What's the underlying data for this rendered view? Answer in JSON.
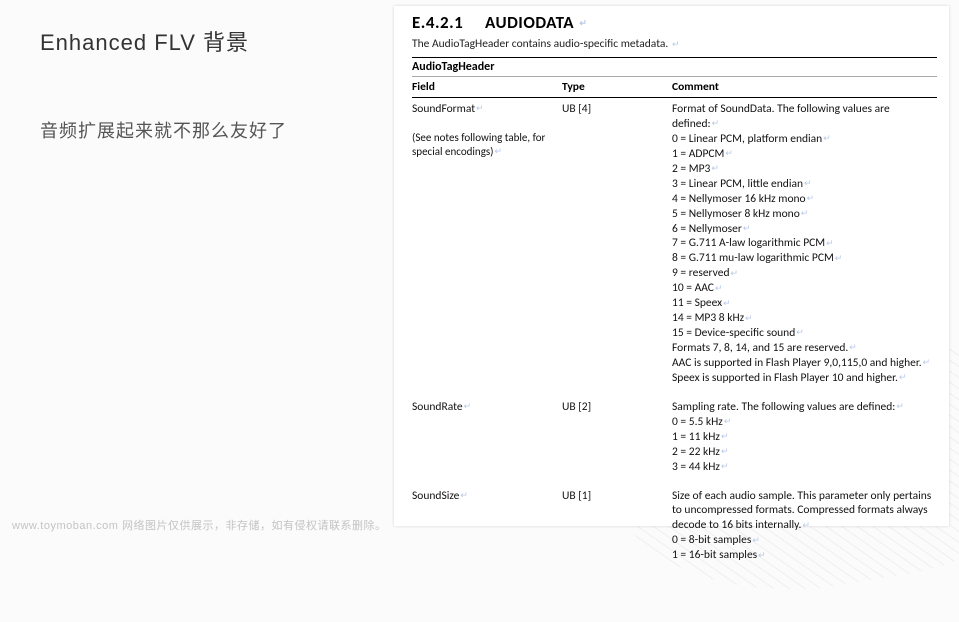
{
  "left": {
    "title": "Enhanced FLV 背景",
    "subtitle": "音频扩展起来就不那么友好了"
  },
  "doc": {
    "heading_num": "E.4.2.1",
    "heading_text": "AUDIODATA",
    "intro": "The AudioTagHeader contains audio-specific metadata.",
    "table_title": "AudioTagHeader",
    "columns": {
      "field": "Field",
      "type": "Type",
      "comment": "Comment"
    },
    "rows": [
      {
        "field": "SoundFormat",
        "field_note": "(See notes following table, for special encodings)",
        "type": "UB [4]",
        "comments": [
          "Format of SoundData. The following values are defined:",
          "0 = Linear PCM, platform endian",
          "1 = ADPCM",
          "2 = MP3",
          "3 = Linear PCM, little endian",
          "4 = Nellymoser 16 kHz mono",
          "5 = Nellymoser 8 kHz mono",
          "6 = Nellymoser",
          "7 = G.711 A-law logarithmic PCM",
          "8 = G.711 mu-law logarithmic PCM",
          "9 = reserved",
          "10 = AAC",
          "11 = Speex",
          "14 = MP3 8 kHz",
          "15 = Device-specific sound",
          "Formats 7, 8, 14, and 15 are reserved.",
          "AAC is supported in Flash Player 9,0,115,0 and higher.",
          "Speex is supported in Flash Player 10 and higher."
        ]
      },
      {
        "field": "SoundRate",
        "type": "UB [2]",
        "comments": [
          "Sampling rate. The following values are defined:",
          "0 = 5.5 kHz",
          "1 = 11 kHz",
          "2 = 22 kHz",
          "3 = 44 kHz"
        ]
      },
      {
        "field": "SoundSize",
        "type": "UB [1]",
        "comments": [
          "Size of each audio sample. This parameter only pertains to uncompressed formats. Compressed formats always decode to 16 bits internally.",
          "0 = 8-bit samples",
          "1 = 16-bit samples"
        ]
      }
    ]
  },
  "footer": "www.toymoban.com 网络图片仅供展示，非存储，如有侵权请联系删除。"
}
